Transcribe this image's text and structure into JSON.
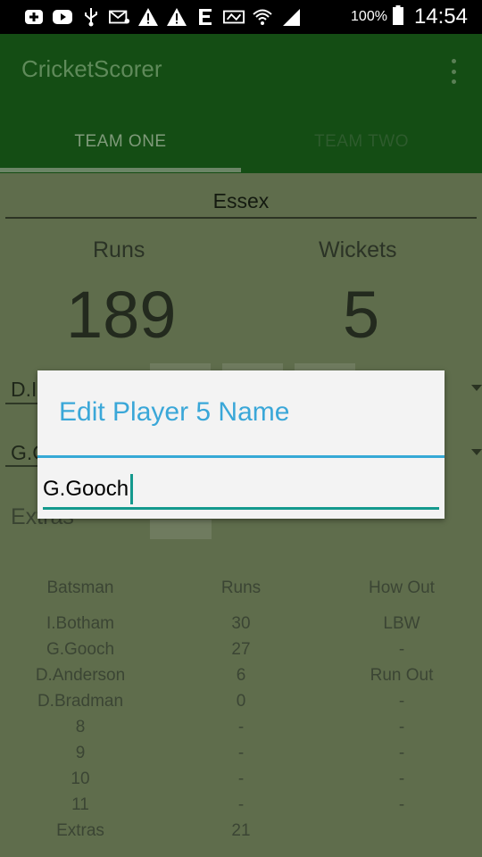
{
  "status_bar": {
    "icons": [
      "plus-icon",
      "youtube-icon",
      "usb-icon",
      "mail-icon",
      "warning-icon",
      "warning-icon",
      "e-icon",
      "nfc-icon",
      "wifi-icon",
      "signal-icon"
    ],
    "battery_pct": "100%",
    "time": "14:54"
  },
  "app_bar": {
    "title": "CricketScorer",
    "tabs": [
      {
        "label": "TEAM ONE"
      },
      {
        "label": "TEAM TWO"
      }
    ]
  },
  "scoreboard": {
    "team_name": "Essex",
    "runs_label": "Runs",
    "wickets_label": "Wickets",
    "runs_value": "189",
    "wickets_value": "5",
    "batsman1_partial": "D.I",
    "batsman2_partial": "G.G",
    "extras_label": "Extras"
  },
  "table": {
    "headers": {
      "batsman": "Batsman",
      "runs": "Runs",
      "how_out": "How Out"
    },
    "rows": [
      {
        "batsman": "I.Botham",
        "runs": "30",
        "how_out": "LBW"
      },
      {
        "batsman": "G.Gooch",
        "runs": "27",
        "how_out": "-"
      },
      {
        "batsman": "D.Anderson",
        "runs": "6",
        "how_out": "Run Out"
      },
      {
        "batsman": "D.Bradman",
        "runs": "0",
        "how_out": "-"
      },
      {
        "batsman": "8",
        "runs": "-",
        "how_out": "-"
      },
      {
        "batsman": "9",
        "runs": "-",
        "how_out": "-"
      },
      {
        "batsman": "10",
        "runs": "-",
        "how_out": "-"
      },
      {
        "batsman": "11",
        "runs": "-",
        "how_out": "-"
      },
      {
        "batsman": "Extras",
        "runs": "21",
        "how_out": ""
      }
    ]
  },
  "dialog": {
    "title": "Edit Player 5 Name",
    "input_value": "G.Gooch"
  }
}
